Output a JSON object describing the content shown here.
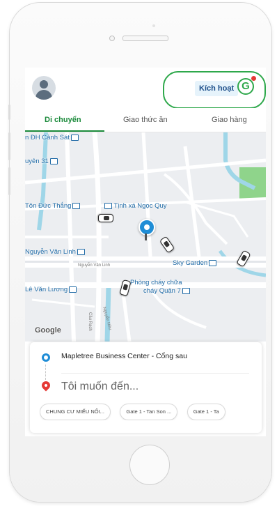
{
  "header": {
    "activate_label": "Kích hoạt",
    "activate_icon_letter": "G",
    "highlight_color": "#2ea84b"
  },
  "tabs": [
    {
      "label": "Di chuyển",
      "active": true
    },
    {
      "label": "Giao thức ăn",
      "active": false
    },
    {
      "label": "Giao hàng",
      "active": false
    }
  ],
  "map": {
    "labels": [
      "n ĐH Cảnh Sát",
      "uyên 31",
      "Tôn Đức Thắng",
      "Tịnh xá Ngọc Quy",
      "Nguyễn Văn Linh",
      "Sky Garden",
      "Lê Văn Lương",
      "Phòng cháy chữa",
      "cháy Quận 7"
    ],
    "street_labels": [
      "Nguyễn Văn Linh",
      "Cầu Rạch",
      "Nguyễn Hữu"
    ],
    "attribution": "Google"
  },
  "booking": {
    "pickup": "Mapletree Business Center - Cổng sau",
    "destination_placeholder": "Tôi muốn đến...",
    "suggestions": [
      "CHUNG CƯ MIẾU NỔI...",
      "Gate 1 - Tan Son ...",
      "Gate 1 - Ta"
    ]
  },
  "colors": {
    "accent_green": "#1b8a3b",
    "pickup_blue": "#1f8dd6",
    "drop_red": "#e53935"
  }
}
